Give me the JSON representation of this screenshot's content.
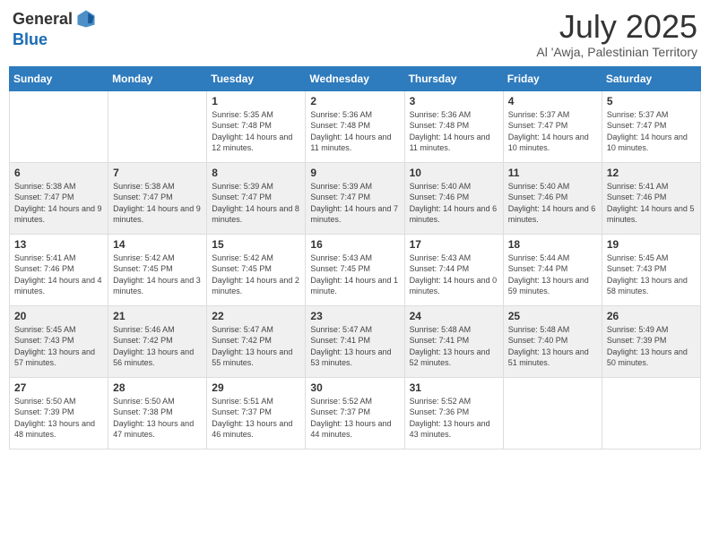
{
  "logo": {
    "text_general": "General",
    "text_blue": "Blue"
  },
  "title": "July 2025",
  "location": "Al 'Awja, Palestinian Territory",
  "days_of_week": [
    "Sunday",
    "Monday",
    "Tuesday",
    "Wednesday",
    "Thursday",
    "Friday",
    "Saturday"
  ],
  "weeks": [
    [
      {
        "day": "",
        "sunrise": "",
        "sunset": "",
        "daylight": ""
      },
      {
        "day": "",
        "sunrise": "",
        "sunset": "",
        "daylight": ""
      },
      {
        "day": "1",
        "sunrise": "Sunrise: 5:35 AM",
        "sunset": "Sunset: 7:48 PM",
        "daylight": "Daylight: 14 hours and 12 minutes."
      },
      {
        "day": "2",
        "sunrise": "Sunrise: 5:36 AM",
        "sunset": "Sunset: 7:48 PM",
        "daylight": "Daylight: 14 hours and 11 minutes."
      },
      {
        "day": "3",
        "sunrise": "Sunrise: 5:36 AM",
        "sunset": "Sunset: 7:48 PM",
        "daylight": "Daylight: 14 hours and 11 minutes."
      },
      {
        "day": "4",
        "sunrise": "Sunrise: 5:37 AM",
        "sunset": "Sunset: 7:47 PM",
        "daylight": "Daylight: 14 hours and 10 minutes."
      },
      {
        "day": "5",
        "sunrise": "Sunrise: 5:37 AM",
        "sunset": "Sunset: 7:47 PM",
        "daylight": "Daylight: 14 hours and 10 minutes."
      }
    ],
    [
      {
        "day": "6",
        "sunrise": "Sunrise: 5:38 AM",
        "sunset": "Sunset: 7:47 PM",
        "daylight": "Daylight: 14 hours and 9 minutes."
      },
      {
        "day": "7",
        "sunrise": "Sunrise: 5:38 AM",
        "sunset": "Sunset: 7:47 PM",
        "daylight": "Daylight: 14 hours and 9 minutes."
      },
      {
        "day": "8",
        "sunrise": "Sunrise: 5:39 AM",
        "sunset": "Sunset: 7:47 PM",
        "daylight": "Daylight: 14 hours and 8 minutes."
      },
      {
        "day": "9",
        "sunrise": "Sunrise: 5:39 AM",
        "sunset": "Sunset: 7:47 PM",
        "daylight": "Daylight: 14 hours and 7 minutes."
      },
      {
        "day": "10",
        "sunrise": "Sunrise: 5:40 AM",
        "sunset": "Sunset: 7:46 PM",
        "daylight": "Daylight: 14 hours and 6 minutes."
      },
      {
        "day": "11",
        "sunrise": "Sunrise: 5:40 AM",
        "sunset": "Sunset: 7:46 PM",
        "daylight": "Daylight: 14 hours and 6 minutes."
      },
      {
        "day": "12",
        "sunrise": "Sunrise: 5:41 AM",
        "sunset": "Sunset: 7:46 PM",
        "daylight": "Daylight: 14 hours and 5 minutes."
      }
    ],
    [
      {
        "day": "13",
        "sunrise": "Sunrise: 5:41 AM",
        "sunset": "Sunset: 7:46 PM",
        "daylight": "Daylight: 14 hours and 4 minutes."
      },
      {
        "day": "14",
        "sunrise": "Sunrise: 5:42 AM",
        "sunset": "Sunset: 7:45 PM",
        "daylight": "Daylight: 14 hours and 3 minutes."
      },
      {
        "day": "15",
        "sunrise": "Sunrise: 5:42 AM",
        "sunset": "Sunset: 7:45 PM",
        "daylight": "Daylight: 14 hours and 2 minutes."
      },
      {
        "day": "16",
        "sunrise": "Sunrise: 5:43 AM",
        "sunset": "Sunset: 7:45 PM",
        "daylight": "Daylight: 14 hours and 1 minute."
      },
      {
        "day": "17",
        "sunrise": "Sunrise: 5:43 AM",
        "sunset": "Sunset: 7:44 PM",
        "daylight": "Daylight: 14 hours and 0 minutes."
      },
      {
        "day": "18",
        "sunrise": "Sunrise: 5:44 AM",
        "sunset": "Sunset: 7:44 PM",
        "daylight": "Daylight: 13 hours and 59 minutes."
      },
      {
        "day": "19",
        "sunrise": "Sunrise: 5:45 AM",
        "sunset": "Sunset: 7:43 PM",
        "daylight": "Daylight: 13 hours and 58 minutes."
      }
    ],
    [
      {
        "day": "20",
        "sunrise": "Sunrise: 5:45 AM",
        "sunset": "Sunset: 7:43 PM",
        "daylight": "Daylight: 13 hours and 57 minutes."
      },
      {
        "day": "21",
        "sunrise": "Sunrise: 5:46 AM",
        "sunset": "Sunset: 7:42 PM",
        "daylight": "Daylight: 13 hours and 56 minutes."
      },
      {
        "day": "22",
        "sunrise": "Sunrise: 5:47 AM",
        "sunset": "Sunset: 7:42 PM",
        "daylight": "Daylight: 13 hours and 55 minutes."
      },
      {
        "day": "23",
        "sunrise": "Sunrise: 5:47 AM",
        "sunset": "Sunset: 7:41 PM",
        "daylight": "Daylight: 13 hours and 53 minutes."
      },
      {
        "day": "24",
        "sunrise": "Sunrise: 5:48 AM",
        "sunset": "Sunset: 7:41 PM",
        "daylight": "Daylight: 13 hours and 52 minutes."
      },
      {
        "day": "25",
        "sunrise": "Sunrise: 5:48 AM",
        "sunset": "Sunset: 7:40 PM",
        "daylight": "Daylight: 13 hours and 51 minutes."
      },
      {
        "day": "26",
        "sunrise": "Sunrise: 5:49 AM",
        "sunset": "Sunset: 7:39 PM",
        "daylight": "Daylight: 13 hours and 50 minutes."
      }
    ],
    [
      {
        "day": "27",
        "sunrise": "Sunrise: 5:50 AM",
        "sunset": "Sunset: 7:39 PM",
        "daylight": "Daylight: 13 hours and 48 minutes."
      },
      {
        "day": "28",
        "sunrise": "Sunrise: 5:50 AM",
        "sunset": "Sunset: 7:38 PM",
        "daylight": "Daylight: 13 hours and 47 minutes."
      },
      {
        "day": "29",
        "sunrise": "Sunrise: 5:51 AM",
        "sunset": "Sunset: 7:37 PM",
        "daylight": "Daylight: 13 hours and 46 minutes."
      },
      {
        "day": "30",
        "sunrise": "Sunrise: 5:52 AM",
        "sunset": "Sunset: 7:37 PM",
        "daylight": "Daylight: 13 hours and 44 minutes."
      },
      {
        "day": "31",
        "sunrise": "Sunrise: 5:52 AM",
        "sunset": "Sunset: 7:36 PM",
        "daylight": "Daylight: 13 hours and 43 minutes."
      },
      {
        "day": "",
        "sunrise": "",
        "sunset": "",
        "daylight": ""
      },
      {
        "day": "",
        "sunrise": "",
        "sunset": "",
        "daylight": ""
      }
    ]
  ]
}
